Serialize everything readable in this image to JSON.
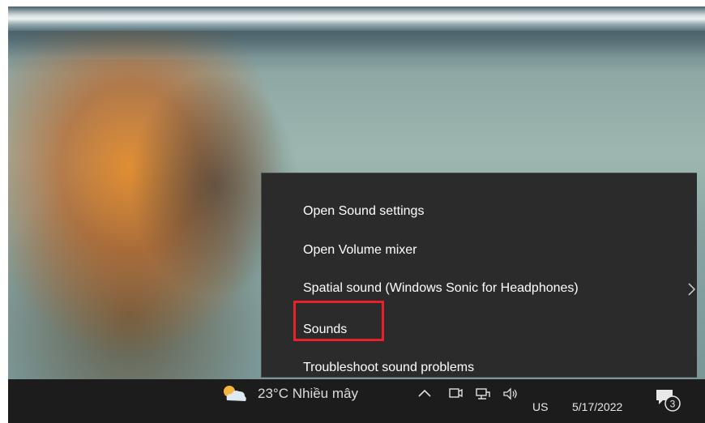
{
  "context_menu": {
    "items": [
      {
        "label": "Open Sound settings"
      },
      {
        "label": "Open Volume mixer"
      },
      {
        "label": "Spatial sound (Windows Sonic for Headphones)",
        "has_submenu": true
      },
      {
        "label": "Sounds",
        "highlighted": true
      },
      {
        "label": "Troubleshoot sound problems"
      }
    ]
  },
  "taskbar": {
    "weather": {
      "icon": "partly-cloudy-icon",
      "text": "23°C  Nhiều mây"
    },
    "tray_icons": [
      "chevron-up-icon",
      "meet-now-icon",
      "network-icon",
      "volume-icon"
    ],
    "language": "US",
    "date": "5/17/2022",
    "notifications": {
      "icon": "action-center-icon",
      "count": "3"
    }
  },
  "colors": {
    "highlight": "#e8202a",
    "menu_bg": "#2b2b2b",
    "taskbar_bg": "#1c1c1c"
  }
}
